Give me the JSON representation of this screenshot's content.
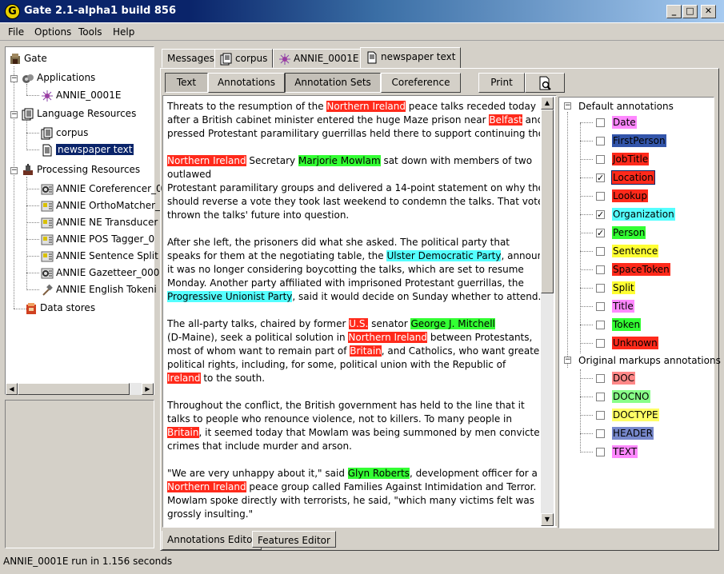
{
  "window": {
    "title": "Gate 2.1-alpha1 build 856",
    "logo": "G"
  },
  "menu": [
    "File",
    "Options",
    "Tools",
    "Help"
  ],
  "tree": {
    "root": "Gate",
    "applications": "Applications",
    "app_item": "ANNIE_0001E",
    "language_resources": "Language Resources",
    "lr_items": [
      "corpus",
      "newspaper text"
    ],
    "processing_resources": "Processing Resources",
    "pr_items": [
      "ANNIE Coreferencer_0",
      "ANNIE OrthoMatcher_",
      "ANNIE NE Transducer",
      "ANNIE POS Tagger_0",
      "ANNIE Sentence Split",
      "ANNIE Gazetteer_000",
      "ANNIE English Tokeni"
    ],
    "data_stores": "Data stores"
  },
  "top_tabs": [
    "Messages",
    "corpus",
    "ANNIE_0001E",
    "newspaper text"
  ],
  "toolbar": {
    "text": "Text",
    "annotations": "Annotations",
    "annotation_sets": "Annotation Sets",
    "coreference": "Coreference",
    "print": "Print"
  },
  "document_lines": [
    [
      [
        "Threats to the resumption of the ",
        ""
      ],
      [
        "Northern Ireland",
        "red"
      ],
      [
        " peace talks receded today",
        ""
      ]
    ],
    [
      [
        "after a British cabinet minister entered the huge Maze prison near ",
        ""
      ],
      [
        "Belfast",
        "red"
      ],
      [
        " and",
        ""
      ]
    ],
    [
      [
        "pressed Protestant paramilitary guerrillas held there to support continuing the discussions.",
        ""
      ]
    ],
    [],
    [
      [
        "Northern Ireland",
        "red"
      ],
      [
        " Secretary ",
        ""
      ],
      [
        "Marjorie Mowlam",
        "green"
      ],
      [
        " sat down with members of two",
        ""
      ]
    ],
    [
      [
        "outlawed",
        ""
      ]
    ],
    [
      [
        "Protestant paramilitary groups and delivered a 14-point statement on why they",
        ""
      ]
    ],
    [
      [
        "should reverse a vote they took last weekend to condemn the talks. That vote had",
        ""
      ]
    ],
    [
      [
        "thrown the talks' future into question.",
        ""
      ]
    ],
    [],
    [
      [
        "After she left, the prisoners did what she asked. The political party that",
        ""
      ]
    ],
    [
      [
        "speaks for them at the negotiating table, the ",
        ""
      ],
      [
        "Ulster Democratic Party",
        "cyan"
      ],
      [
        ", announced",
        ""
      ]
    ],
    [
      [
        "it was no longer considering boycotting the talks, which are set to resume",
        ""
      ]
    ],
    [
      [
        "Monday. Another party affiliated with imprisoned Protestant guerrillas, the",
        ""
      ]
    ],
    [
      [
        "Progressive Unionist Party",
        "cyan"
      ],
      [
        ", said it would decide on Sunday whether to attend.",
        ""
      ]
    ],
    [],
    [
      [
        "The all-party talks, chaired by former ",
        ""
      ],
      [
        "U.S.",
        "red"
      ],
      [
        " senator ",
        ""
      ],
      [
        "George J. Mitchell",
        "green"
      ]
    ],
    [
      [
        "(D-Maine), seek a political solution in ",
        ""
      ],
      [
        "Northern Ireland",
        "red"
      ],
      [
        " between Protestants,",
        ""
      ]
    ],
    [
      [
        "most of whom want to remain part of ",
        ""
      ],
      [
        "Britain",
        "red"
      ],
      [
        ", and Catholics, who want greater",
        ""
      ]
    ],
    [
      [
        "political rights, including, for some, political union with the Republic of",
        ""
      ]
    ],
    [
      [
        "Ireland",
        "red"
      ],
      [
        " to the south.",
        ""
      ]
    ],
    [],
    [
      [
        "Throughout the conflict, the British government has held to the line that it",
        ""
      ]
    ],
    [
      [
        "talks to people who renounce violence, not to killers. To many people in",
        ""
      ]
    ],
    [
      [
        "Britain",
        "red"
      ],
      [
        ", it seemed today that Mowlam was being summoned by men convicted of",
        ""
      ]
    ],
    [
      [
        "crimes that include murder and arson.",
        ""
      ]
    ],
    [],
    [
      [
        "\"We are very unhappy about it,\" said ",
        ""
      ],
      [
        "Glyn Roberts",
        "green"
      ],
      [
        ", development officer for a",
        ""
      ]
    ],
    [
      [
        "Northern Ireland",
        "red"
      ],
      [
        " peace group called Families Against Intimidation and Terror.",
        ""
      ]
    ],
    [
      [
        "Mowlam spoke directly with terrorists, he said, \"which many victims felt was",
        ""
      ]
    ],
    [
      [
        "grossly insulting.\"",
        ""
      ]
    ]
  ],
  "annotation_sets": {
    "default_label": "Default annotations",
    "default": [
      {
        "name": "Date",
        "checked": false,
        "color": "#ff88ff",
        "fg": "#000000"
      },
      {
        "name": "FirstPerson",
        "checked": false,
        "color": "#3355aa",
        "fg": "#000000"
      },
      {
        "name": "JobTitle",
        "checked": false,
        "color": "#ff2a1b",
        "fg": "#000000"
      },
      {
        "name": "Location",
        "checked": true,
        "color": "#ff2a1b",
        "fg": "#000000"
      },
      {
        "name": "Lookup",
        "checked": false,
        "color": "#ff2a1b",
        "fg": "#000000"
      },
      {
        "name": "Organization",
        "checked": true,
        "color": "#55ffff",
        "fg": "#000000"
      },
      {
        "name": "Person",
        "checked": true,
        "color": "#33ff33",
        "fg": "#000000"
      },
      {
        "name": "Sentence",
        "checked": false,
        "color": "#ffff33",
        "fg": "#000000"
      },
      {
        "name": "SpaceToken",
        "checked": false,
        "color": "#ff2a1b",
        "fg": "#000000"
      },
      {
        "name": "Split",
        "checked": false,
        "color": "#ffff33",
        "fg": "#000000"
      },
      {
        "name": "Title",
        "checked": false,
        "color": "#ff88ff",
        "fg": "#000000"
      },
      {
        "name": "Token",
        "checked": false,
        "color": "#33ff33",
        "fg": "#000000"
      },
      {
        "name": "Unknown",
        "checked": false,
        "color": "#ff2a1b",
        "fg": "#000000"
      }
    ],
    "original_label": "Original markups annotations",
    "original": [
      {
        "name": "DOC",
        "checked": false,
        "color": "#ff8888",
        "fg": "#000000"
      },
      {
        "name": "DOCNO",
        "checked": false,
        "color": "#88ff88",
        "fg": "#000000"
      },
      {
        "name": "DOCTYPE",
        "checked": false,
        "color": "#ffff66",
        "fg": "#000000"
      },
      {
        "name": "HEADER",
        "checked": false,
        "color": "#7788cc",
        "fg": "#000000"
      },
      {
        "name": "TEXT",
        "checked": false,
        "color": "#ff88ff",
        "fg": "#000000"
      }
    ]
  },
  "bottom_tabs": [
    "Annotations Editor",
    "Features Editor"
  ],
  "status": "ANNIE_0001E run in 1.156 seconds",
  "colors": {
    "red": "#ff2a1b",
    "green": "#33ff33",
    "cyan": "#55ffff",
    "selection": "#0a246a"
  }
}
